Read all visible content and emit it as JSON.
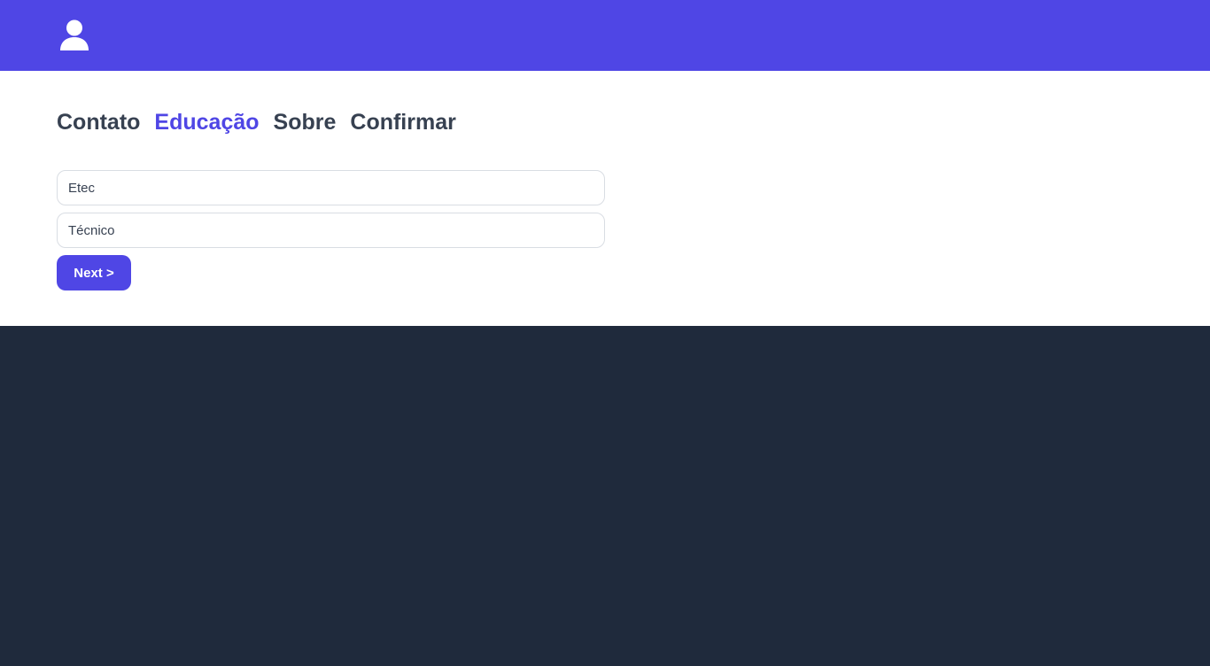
{
  "header": {
    "icon": "user-icon",
    "background": "#4f46e5"
  },
  "steps": [
    {
      "label": "Contato",
      "active": false
    },
    {
      "label": "Educação",
      "active": true
    },
    {
      "label": "Sobre",
      "active": false
    },
    {
      "label": "Confirmar",
      "active": false
    }
  ],
  "form": {
    "institution": {
      "value": "Etec"
    },
    "course": {
      "value": "Técnico"
    },
    "next_label": "Next >"
  },
  "colors": {
    "accent": "#4f46e5",
    "dark_background": "#1f2a3c",
    "tab_text": "#374151"
  }
}
